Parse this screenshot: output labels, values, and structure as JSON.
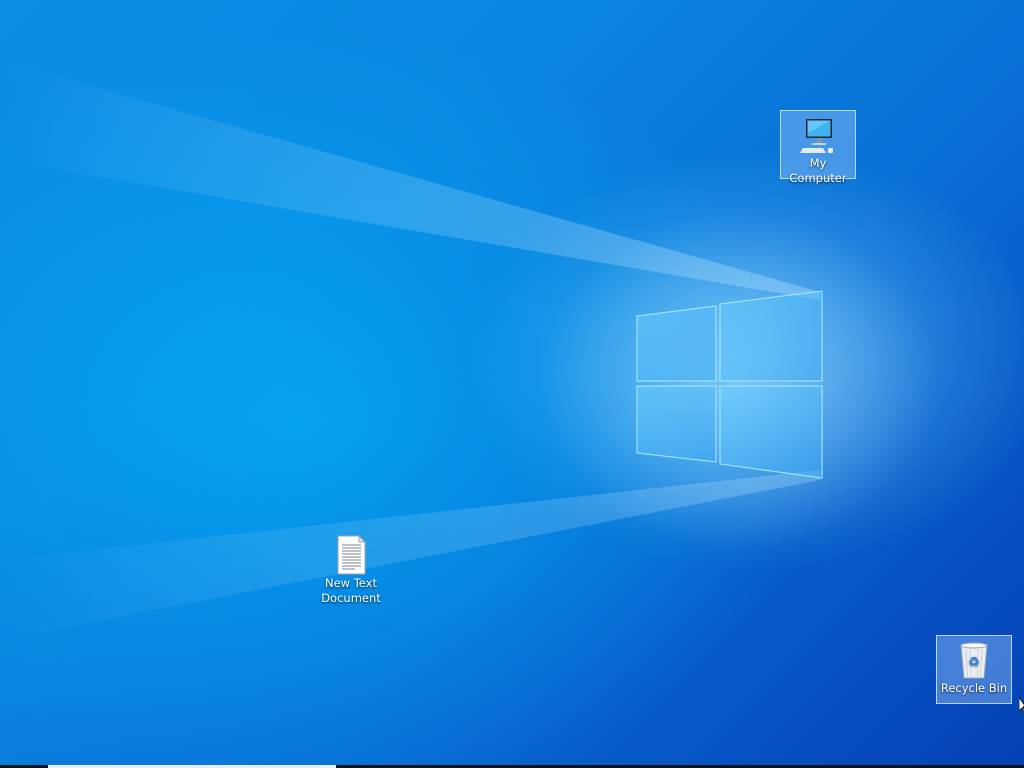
{
  "desktop": {
    "wallpaper": "windows-10-hero",
    "colors": {
      "background_light": "#0b8ee6",
      "background_dark": "#0541b4",
      "logo_glow": "#7fd4ff",
      "selection_fill": "#9bc8ff"
    },
    "icons": [
      {
        "label": "My Computer",
        "icon": "computer-icon",
        "selected": true
      },
      {
        "label": "New Text\nDocument",
        "icon": "text-document-icon",
        "selected": false
      },
      {
        "label": "Recycle Bin",
        "icon": "recycle-bin-icon",
        "selected": true
      }
    ]
  }
}
